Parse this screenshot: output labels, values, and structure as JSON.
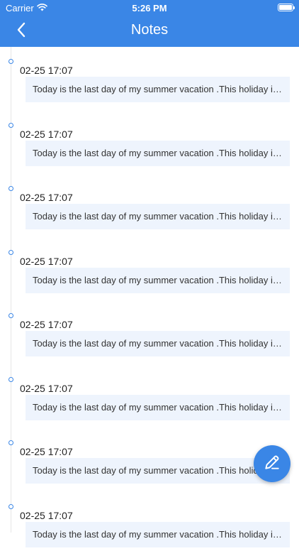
{
  "status_bar": {
    "carrier": "Carrier",
    "time": "5:26 PM"
  },
  "nav": {
    "title": "Notes"
  },
  "colors": {
    "accent": "#3a86e6",
    "note_bg": "#eef4fd"
  },
  "notes": [
    {
      "time": "02-25 17:07",
      "text": "Today is the last day of my summer vacation .This holiday is..."
    },
    {
      "time": "02-25 17:07",
      "text": "Today is the last day of my summer vacation .This holiday is..."
    },
    {
      "time": "02-25 17:07",
      "text": "Today is the last day of my summer vacation .This holiday is..."
    },
    {
      "time": "02-25 17:07",
      "text": "Today is the last day of my summer vacation .This holiday is..."
    },
    {
      "time": "02-25 17:07",
      "text": "Today is the last day of my summer vacation .This holiday is..."
    },
    {
      "time": "02-25 17:07",
      "text": "Today is the last day of my summer vacation .This holiday is..."
    },
    {
      "time": "02-25 17:07",
      "text": "Today is the last day of my summer vacation .This holiday is..."
    },
    {
      "time": "02-25 17:07",
      "text": "Today is the last day of my summer vacation .This holiday is..."
    }
  ]
}
